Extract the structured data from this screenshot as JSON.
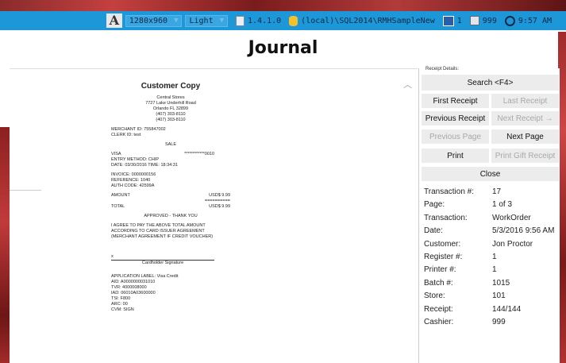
{
  "statusbar": {
    "font_icon_letter": "A",
    "resolution": "1280x960",
    "theme": "Light",
    "version": "1.4.1.0",
    "database": "(local)\\SQL2014\\RMHSampleNew",
    "register": "1",
    "printer": "999",
    "clock": "9:57 AM"
  },
  "page_title": "Journal",
  "receipt": {
    "copy_title": "Customer Copy",
    "store_lines": [
      "Central Stores",
      "7727 Lake Underhill Road",
      "Orlando FL 32899",
      "(407) 303-8110",
      "(407) 303-8110"
    ],
    "merchant_id": "MERCHANT ID: 755847002",
    "clerk_id": "CLERK ID: test",
    "sale": "SALE",
    "card_type": "VISA",
    "card_number": "************0010",
    "entry_method": "ENTRY METHOD: CHIP",
    "date_time": "DATE: 03/30/2016   TIME: 18:34:31",
    "invoice": "INVOICE: 0000000156",
    "reference": "REFERENCE: 1040",
    "auth_code": "AUTH CODE: 42599A",
    "amount_label": "AMOUNT",
    "amount_value": "USD$ 9.99",
    "amount_rule": "==========",
    "total_label": "TOTAL",
    "total_value": "USD$ 9.99",
    "approved": "APPROVED - THANK YOU",
    "agreement_lines": [
      "I AGREE TO PAY THE ABOVE TOTAL AMOUNT",
      "ACCORDING TO CARD ISSUER AGREEMENT",
      "(MERCHANT AGREEMENT IF CREDIT VOUCHER)"
    ],
    "sig_x": "x",
    "sig_label": "Cardholder Signature",
    "emv_lines": [
      "APPLICATION LABEL: Visa Credit",
      "AID: A0000000031010",
      "TVR: 4000008000",
      "IAD: 06010A03600000",
      "TSI: F800",
      "ARC: 00",
      "CVM: SIGN"
    ]
  },
  "panel": {
    "legend": "Receipt Details:",
    "search": "Search <F4>",
    "first_receipt": "First Receipt",
    "last_receipt": "Last Receipt",
    "previous_receipt": "Previous Receipt ←",
    "next_receipt": "Next Receipt →",
    "previous_page": "Previous Page",
    "next_page": "Next Page",
    "print": "Print",
    "print_gift": "Print Gift Receipt",
    "close": "Close"
  },
  "details": [
    {
      "label": "Transaction #:",
      "value": "17"
    },
    {
      "label": "Page:",
      "value": "1 of 3"
    },
    {
      "label": "Transaction:",
      "value": "WorkOrder"
    },
    {
      "label": "Date:",
      "value": "5/3/2016 9:56 AM"
    },
    {
      "label": "Customer:",
      "value": "Jon Proctor"
    },
    {
      "label": "Register #:",
      "value": "1"
    },
    {
      "label": "Printer #:",
      "value": "1"
    },
    {
      "label": "Batch #:",
      "value": "1015"
    },
    {
      "label": "Store:",
      "value": "101"
    },
    {
      "label": "Receipt:",
      "value": "144/144"
    },
    {
      "label": "Cashier:",
      "value": "999"
    }
  ]
}
